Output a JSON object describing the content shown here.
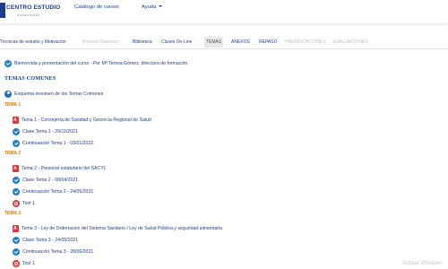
{
  "header": {
    "logo_text": "CENTRO ESTUDIO",
    "logo_subtext": "OPOSICIONES",
    "nav": [
      {
        "label": "Catálogo de cursos"
      },
      {
        "label": "Ayuda"
      }
    ]
  },
  "tabs": [
    {
      "label": "Técnicas de estudio y Motivación",
      "state": "enabled"
    },
    {
      "label": "Proceso Selectivo",
      "state": "disabled"
    },
    {
      "label": "Biblioteca",
      "state": "enabled"
    },
    {
      "label": "Clases On-Line",
      "state": "enabled"
    },
    {
      "label": "TEMAS",
      "state": "active"
    },
    {
      "label": "ANEXOS",
      "state": "enabled"
    },
    {
      "label": "REPASO",
      "state": "enabled"
    },
    {
      "label": "PRESENTACIONES",
      "state": "disabled"
    },
    {
      "label": "EVALUACIONES",
      "state": "disabled"
    }
  ],
  "content": {
    "intro": "Bienvenida y presentación del curso - Por Mª Teresa Gómez, directora de formación",
    "section_title": "TEMAS COMUNES",
    "summary": "Esquema-resumen de los Temas Comunes",
    "temas": [
      {
        "heading": "TEMA 1",
        "items": [
          {
            "icon": "pdf-icon",
            "label": "Tema 1 - Consejería de Sanidad y Gerencia Regional de Salud"
          },
          {
            "icon": "check-icon",
            "label": "Clase Tema 1 - 29/11/2021"
          },
          {
            "icon": "check-icon",
            "label": "Continuación Tema 1 - 03/01/2022"
          }
        ]
      },
      {
        "heading": "TEMA 2",
        "items": [
          {
            "icon": "pdf-icon",
            "label": "Tema 2 - Personal estatutario del SACYL"
          },
          {
            "icon": "check-icon",
            "label": "Clase Tema 2 - 08/04/2021"
          },
          {
            "icon": "check-icon",
            "label": "Continuación Tema 2 - 24/05/2021"
          },
          {
            "icon": "test-icon",
            "label": "Test 1"
          }
        ]
      },
      {
        "heading": "TEMA 3",
        "items": [
          {
            "icon": "pdf-icon",
            "label": "Tema 3 - Ley de Ordenacion del Sistema Sanitario / Ley de Salud Pública y seguridad alimentaria"
          },
          {
            "icon": "check-icon",
            "label": "Clase Tema 3 - 24/05/2021"
          },
          {
            "icon": "check-icon",
            "label": "Continuación Tema 3 - 28/06/2021"
          },
          {
            "icon": "test-icon",
            "label": "Test 1"
          }
        ]
      }
    ]
  },
  "watermark": "Activar Windows",
  "colors": {
    "link": "#23408e",
    "heading_orange": "#e07a12",
    "tab_disabled": "#b8bec8",
    "check_icon": "#1e7fc4",
    "test_icon": "#e03a3a"
  }
}
